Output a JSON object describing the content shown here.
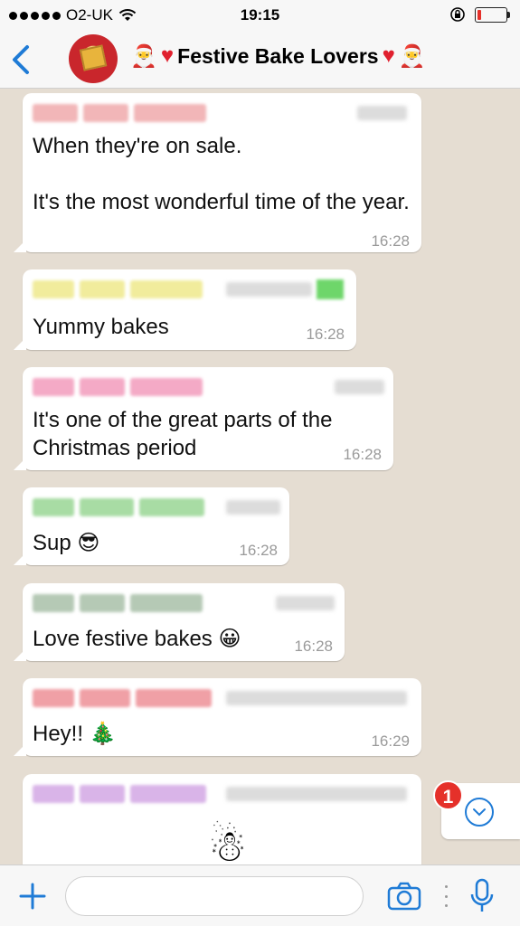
{
  "status_bar": {
    "carrier": "O2-UK",
    "time": "19:15",
    "battery_level": 0.12,
    "battery_color": "#e5302a"
  },
  "header": {
    "title": "Festive Bake Lovers",
    "icons": [
      "back-chevron",
      "santa-emoji",
      "heart-emoji"
    ],
    "accent_color": "#1f7bd6"
  },
  "messages": [
    {
      "text": "When they're on sale.\n\nIt's the most wonderful time of the year.",
      "time": "16:28",
      "sender_color": "#f2b6b8"
    },
    {
      "text": "Yummy bakes",
      "time": "16:28",
      "sender_color": "#f1ec9c"
    },
    {
      "text": "It's one of the great parts of the Christmas period",
      "time": "16:28",
      "sender_color": "#f4aac6"
    },
    {
      "text": "Sup 😎",
      "time": "16:28",
      "sender_color": "#a8dca4"
    },
    {
      "text": "Love festive bakes 😀",
      "time": "16:28",
      "sender_color": "#b5c9b5"
    },
    {
      "text": "Hey!! 🎄",
      "time": "16:29",
      "sender_color": "#f0a0a6"
    },
    {
      "text": "",
      "time": "",
      "sender_color": "#d9b4e8",
      "emoji": "☃"
    }
  ],
  "scroll_down": {
    "badge": "1"
  },
  "input_bar": {
    "placeholder": ""
  }
}
